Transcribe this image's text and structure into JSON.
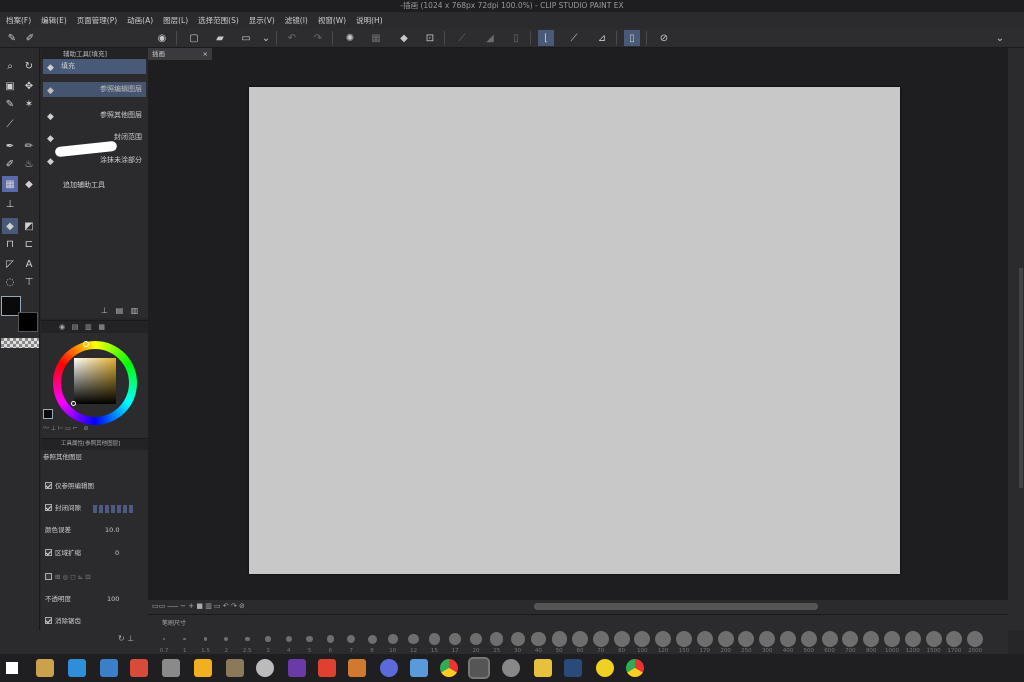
{
  "window": {
    "title": "-插画 (1024 x 768px 72dpi 100.0%)  - CLIP STUDIO PAINT EX"
  },
  "menu": [
    "档案(F)",
    "编辑(E)",
    "页面管理(P)",
    "动画(A)",
    "图层(L)",
    "选择范围(S)",
    "显示(V)",
    "滤镜(I)",
    "视窗(W)",
    "说明(H)"
  ],
  "canvas_tab": {
    "label": "插画",
    "close": "×"
  },
  "subtool_panel": {
    "tab_label": "辅助工具[填充]",
    "items": [
      {
        "label": "填充",
        "icon": "fill-icon"
      },
      {
        "label": "参照编辑图层",
        "icon": "fill-icon"
      },
      {
        "label": "参照其他图层",
        "icon": "fill-icon"
      },
      {
        "label": "封闭范围",
        "icon": "fill-icon"
      },
      {
        "label": "涂抹未涂部分",
        "icon": "fill-icon"
      }
    ],
    "add_tool": "追加辅助工具"
  },
  "color_panel": {
    "main_color": "#0a0a0a",
    "sub_color": "#000000"
  },
  "tool_property": {
    "tab_label": "工具属性[参照其他图层]",
    "subtitle": "参照其他图层",
    "props": [
      {
        "label": "仅参照编辑图",
        "checked": true
      },
      {
        "label": "封闭间隙",
        "checked": true
      },
      {
        "label": "颜色误差",
        "value": "10.0"
      },
      {
        "label": "区域扩缩",
        "value": "0",
        "checked": true
      },
      {
        "label": "不透明度",
        "value": "100"
      },
      {
        "label": "消除锯齿",
        "checked": true
      }
    ]
  },
  "brush_size_panel": {
    "tab_label": "笔刷尺寸",
    "sizes": [
      "0.7",
      "1",
      "1.5",
      "2",
      "2.5",
      "3",
      "4",
      "5",
      "6",
      "7",
      "8",
      "10",
      "12",
      "15",
      "17",
      "20",
      "25",
      "30",
      "40",
      "50",
      "60",
      "70",
      "80",
      "100",
      "120",
      "150",
      "170",
      "200",
      "250",
      "300",
      "400",
      "500",
      "600",
      "700",
      "800",
      "1000",
      "1200",
      "1500",
      "1700",
      "2000"
    ]
  }
}
